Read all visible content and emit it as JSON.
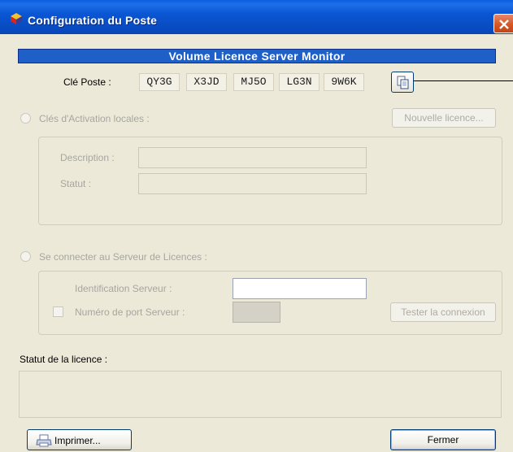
{
  "window": {
    "title": "Configuration du Poste",
    "close_symbol": "×",
    "icon": "app-cube-icon"
  },
  "banner": "Volume Licence Server Monitor",
  "key": {
    "label": "Clé Poste :",
    "parts": [
      "QY3G",
      "X3JD",
      "MJ5O",
      "LG3N",
      "9W6K"
    ],
    "copy_icon": "copy-icon"
  },
  "local": {
    "radio_label": "Clés d'Activation locales :",
    "new_license_button": "Nouvelle licence...",
    "description_label": "Description :",
    "status_label": "Statut :",
    "description_value": "",
    "status_value": ""
  },
  "server": {
    "radio_label": "Se connecter au Serveur de Licences :",
    "id_label": "Identification Serveur :",
    "id_value": "",
    "port_label": "Numéro de port Serveur :",
    "port_value": "",
    "test_button": "Tester la connexion"
  },
  "license_status": {
    "label": "Statut de la licence :",
    "value": ""
  },
  "footer": {
    "print_button": "Imprimer...",
    "close_button": "Fermer",
    "print_icon": "printer-icon"
  },
  "colors": {
    "titlebar": "#0a56d4",
    "banner": "#1e5fc8",
    "window_bg": "#ece9d8",
    "close_button": "#d4541f"
  }
}
